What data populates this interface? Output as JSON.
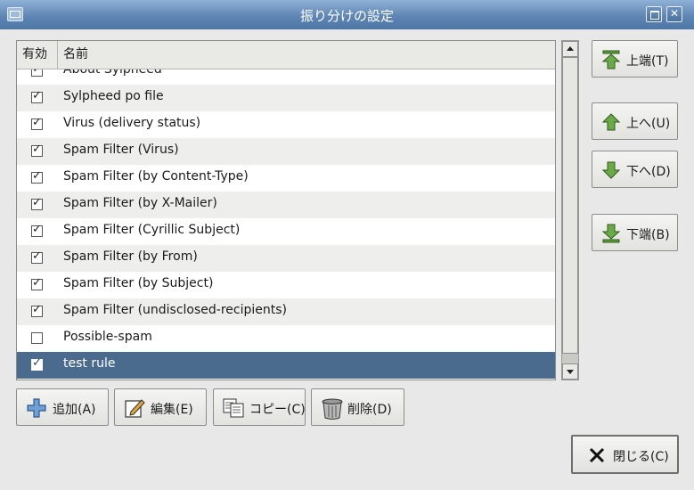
{
  "window": {
    "title": "振り分けの設定"
  },
  "list": {
    "columns": {
      "enabled": "有効",
      "name": "名前"
    },
    "rows": [
      {
        "name": "About Sylpheed",
        "checked": true
      },
      {
        "name": "Sylpheed po file",
        "checked": true
      },
      {
        "name": "Virus (delivery status)",
        "checked": true
      },
      {
        "name": "Spam Filter (Virus)",
        "checked": true
      },
      {
        "name": "Spam Filter (by Content-Type)",
        "checked": true
      },
      {
        "name": "Spam Filter (by X-Mailer)",
        "checked": true
      },
      {
        "name": "Spam Filter (Cyrillic Subject)",
        "checked": true
      },
      {
        "name": "Spam Filter (by From)",
        "checked": true
      },
      {
        "name": "Spam Filter (by Subject)",
        "checked": true
      },
      {
        "name": "Spam Filter (undisclosed-recipients)",
        "checked": true
      },
      {
        "name": "Possible-spam",
        "checked": false
      },
      {
        "name": "test rule",
        "checked": true,
        "selected": true
      }
    ]
  },
  "move": {
    "top": "上端(T)",
    "up": "上へ(U)",
    "down": "下へ(D)",
    "bottom": "下端(B)"
  },
  "actions": {
    "add": "追加(A)",
    "edit": "編集(E)",
    "copy": "コピー(C)",
    "delete": "削除(D)"
  },
  "close": "閉じる(C)",
  "icons": {
    "move": "green-arrow-icon",
    "add": "plus-icon",
    "edit": "edit-icon",
    "copy": "copy-icon",
    "delete": "trash-icon",
    "close": "close-x-icon"
  },
  "colors": {
    "selection": "#4a6b8e",
    "titlebar": "#5f86b4",
    "arrow_green": "#5e9c3c"
  }
}
